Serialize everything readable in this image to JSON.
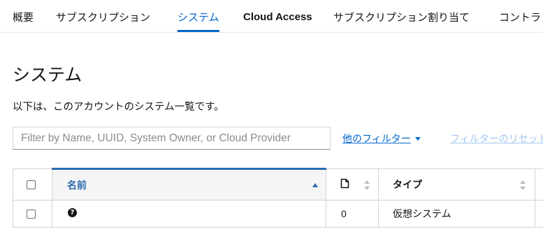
{
  "nav": {
    "tabs": [
      {
        "label": "概要"
      },
      {
        "label": "サブスクリプション"
      },
      {
        "label": "システム"
      },
      {
        "label": "Cloud Access"
      },
      {
        "label": "サブスクリプション割り当て"
      },
      {
        "label": "コントラ"
      }
    ],
    "active_tab": "システム",
    "active_color": "#0066cc"
  },
  "page": {
    "title": "システム",
    "description": "以下は、このアカウントのシステム一覧です。"
  },
  "toolbar": {
    "search_placeholder": "Filter by Name, UUID, System Owner, or Cloud Provider",
    "search_value": "",
    "more_filters_label": "他のフィルター",
    "reset_filters_label": "フィルターのリセット"
  },
  "table": {
    "columns": {
      "name": "名前",
      "type": "タイプ"
    },
    "rows": [
      {
        "name_icon": "question-circle-icon",
        "count": "0",
        "type": "仮想システム"
      }
    ]
  }
}
